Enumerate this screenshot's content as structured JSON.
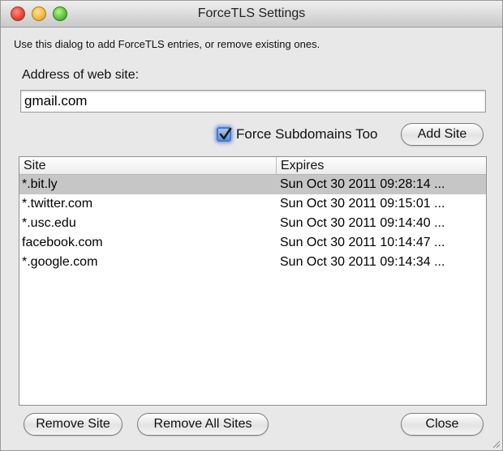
{
  "window": {
    "title": "ForceTLS Settings"
  },
  "dialog": {
    "instructions": "Use this dialog to add ForceTLS entries, or remove existing ones.",
    "address_label": "Address of web site:",
    "address_value": "gmail.com",
    "checkbox_label": "Force Subdomains Too",
    "checkbox_checked": true,
    "add_button": "Add Site"
  },
  "table": {
    "columns": [
      "Site",
      "Expires"
    ],
    "rows": [
      {
        "site": "*.bit.ly",
        "expires": "Sun Oct 30 2011 09:28:14 ...",
        "selected": true
      },
      {
        "site": "*.twitter.com",
        "expires": "Sun Oct 30 2011 09:15:01 ..."
      },
      {
        "site": "*.usc.edu",
        "expires": "Sun Oct 30 2011 09:14:40 ..."
      },
      {
        "site": "facebook.com",
        "expires": "Sun Oct 30 2011 10:14:47 ..."
      },
      {
        "site": "*.google.com",
        "expires": "Sun Oct 30 2011 09:14:34 ..."
      }
    ]
  },
  "footer": {
    "remove_button": "Remove Site",
    "remove_all_button": "Remove All Sites",
    "close_button": "Close"
  },
  "colors": {
    "selection": "#c6c6c6",
    "checkbox_accent": "#5b8fdc"
  }
}
